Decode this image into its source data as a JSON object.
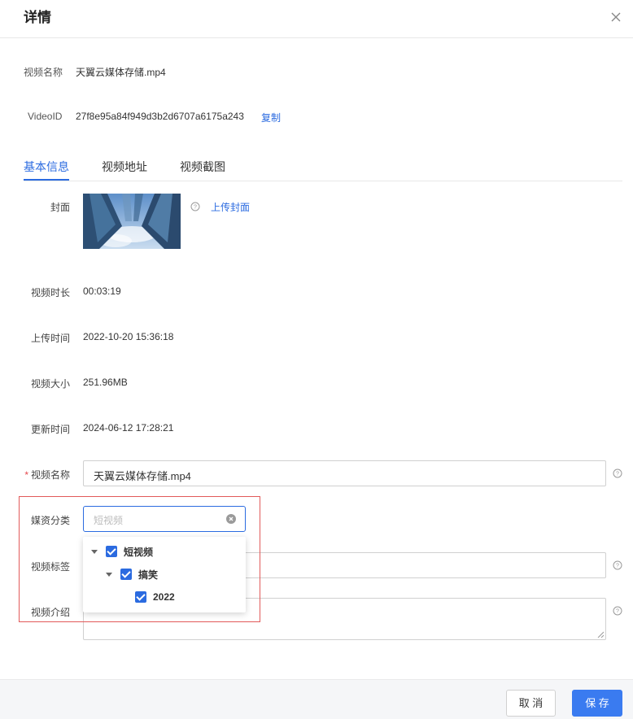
{
  "dialog": {
    "title": "详情"
  },
  "info": {
    "video_name_label": "视频名称",
    "video_name_value": "天翼云媒体存储.mp4",
    "video_id_label": "VideoID",
    "video_id_value": "27f8e95a84f949d3b2d6707a6175a243",
    "copy_label": "复制"
  },
  "tabs": [
    {
      "label": "基本信息",
      "active": true
    },
    {
      "label": "视频地址",
      "active": false
    },
    {
      "label": "视频截图",
      "active": false
    }
  ],
  "form": {
    "cover_label": "封面",
    "upload_cover_label": "上传封面",
    "duration_label": "视频时长",
    "duration_value": "00:03:19",
    "upload_time_label": "上传时间",
    "upload_time_value": "2022-10-20 15:36:18",
    "size_label": "视频大小",
    "size_value": "251.96MB",
    "update_time_label": "更新时间",
    "update_time_value": "2024-06-12 17:28:21",
    "name_required_mark": "*",
    "name_label": "视频名称",
    "name_value": "天翼云媒体存储.mp4",
    "category_label": "媒资分类",
    "category_placeholder": "短视频",
    "tags_label": "视频标签",
    "tags_value": "",
    "intro_label": "视频介绍",
    "intro_value": ""
  },
  "category_tree": [
    {
      "label": "短视频",
      "level": 0,
      "checked": true,
      "expanded": true
    },
    {
      "label": "搞笑",
      "level": 1,
      "checked": true,
      "expanded": true
    },
    {
      "label": "2022",
      "level": 2,
      "checked": true,
      "expanded": false
    }
  ],
  "footer": {
    "cancel_label": "取 消",
    "save_label": "保 存"
  },
  "colors": {
    "accent": "#2b6be0",
    "primary_button": "#3a7bf0",
    "highlight_border": "#e25a5a",
    "required": "#e5484d"
  }
}
